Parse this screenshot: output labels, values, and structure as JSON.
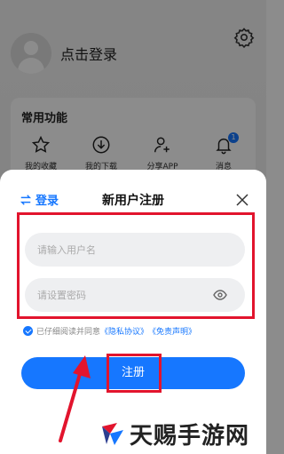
{
  "profile": {
    "login_prompt": "点击登录"
  },
  "functions": {
    "title": "常用功能",
    "items": [
      {
        "label": "我的收藏",
        "icon": "star-icon"
      },
      {
        "label": "我的下载",
        "icon": "download-icon"
      },
      {
        "label": "分享APP",
        "icon": "add-user-icon"
      },
      {
        "label": "消息",
        "icon": "bell-icon",
        "badge": "1"
      }
    ]
  },
  "sheet": {
    "switch_login": "登录",
    "title": "新用户注册",
    "username_placeholder": "请输入用户名",
    "password_placeholder": "请设置密码",
    "agreement": {
      "prefix": "已仔细阅读并同意",
      "privacy": "《隐私协议》",
      "disclaimer": "《免责声明》"
    },
    "register_label": "注册"
  },
  "watermark": {
    "text": "天赐手游网"
  },
  "colors": {
    "accent": "#1677ff",
    "highlight": "#e2142d"
  }
}
